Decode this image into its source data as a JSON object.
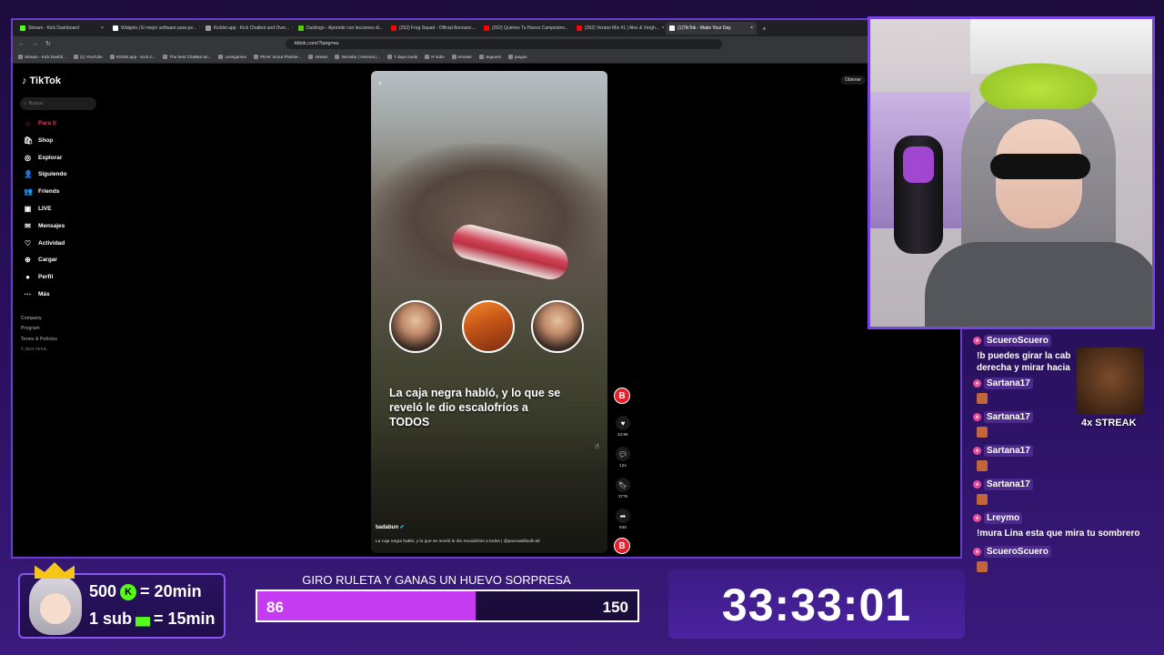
{
  "browser": {
    "tabs": [
      {
        "label": "Stream - Kick Dashboard",
        "color": "#53fc18"
      },
      {
        "label": "Widgets | El mejor software para pe...",
        "color": "#ffffff"
      },
      {
        "label": "Kicklet.app - Kick Chatbot and Over...",
        "color": "#9b9b9b"
      },
      {
        "label": "Duolingo - Aprende con lecciones di...",
        "color": "#58cc02"
      },
      {
        "label": "(262) Frog Squad - Official Announc...",
        "color": "#ff0000"
      },
      {
        "label": "(262) Quieres Tu Huevo Campesino...",
        "color": "#ff0000"
      },
      {
        "label": "(262) Verano Mix #1 | Alex & Vergh...",
        "color": "#ff0000"
      },
      {
        "label": "(1)TikTok - Make Your Day",
        "color": "#ffffff"
      }
    ],
    "url": "tiktok.com/?lang=es",
    "bookmarks": [
      "Stream - Kick Dashb...",
      "(1) YouTube",
      "Kicklet.app - Kick C...",
      "The best ChatBot an...",
      "Lessgames",
      "PEAK Scout Plushie...",
      "stream",
      "Servidor | Aternos |...",
      "7 days mods",
      "R subs",
      "emotes",
      "Jeguoes",
      "juegos"
    ]
  },
  "tiktok": {
    "logo": "TikTok",
    "search_placeholder": "Buscar",
    "nav": [
      {
        "label": "Para ti",
        "icon": "home-icon",
        "glyph": "⌂"
      },
      {
        "label": "Shop",
        "icon": "shop-icon",
        "glyph": "🛍"
      },
      {
        "label": "Explorar",
        "icon": "compass-icon",
        "glyph": "◎"
      },
      {
        "label": "Siguiendo",
        "icon": "following-icon",
        "glyph": "👤"
      },
      {
        "label": "Friends",
        "icon": "friends-icon",
        "glyph": "👥"
      },
      {
        "label": "LIVE",
        "icon": "live-icon",
        "glyph": "▣"
      },
      {
        "label": "Mensajes",
        "icon": "messages-icon",
        "glyph": "✉"
      },
      {
        "label": "Actividad",
        "icon": "activity-icon",
        "glyph": "♡"
      },
      {
        "label": "Cargar",
        "icon": "upload-icon",
        "glyph": "⊕"
      },
      {
        "label": "Perfil",
        "icon": "profile-icon",
        "glyph": "●"
      },
      {
        "label": "Más",
        "icon": "more-icon",
        "glyph": "···"
      }
    ],
    "footer": [
      "Company",
      "Program",
      "Terms & Policies",
      "© 2024 TikTok"
    ],
    "get_app": "Obtener",
    "video": {
      "caption": "La caja negra habló, y lo que se reveló le dio escalofríos a TODOS",
      "author": "badabun",
      "description": "La caja negra habló, y lo que se reveló le dio escalofríos a todos | @paocastillooficial"
    },
    "actions": {
      "likes": "43.9K",
      "comments": "124",
      "saves": "3776",
      "shares": "848"
    }
  },
  "chat": {
    "messages": [
      {
        "user": "ScueroScuero",
        "text": "!b puedes girar la cab derecha y mirar hacia"
      },
      {
        "user": "Sartana17",
        "text": ""
      },
      {
        "user": "Sartana17",
        "text": ""
      },
      {
        "user": "Sartana17",
        "text": ""
      },
      {
        "user": "Sartana17",
        "text": ""
      },
      {
        "user": "Lreymo",
        "text": "!mura Lina esta que mira tu sombrero"
      },
      {
        "user": "ScueroScuero",
        "text": ""
      }
    ],
    "streak": "4x STREAK"
  },
  "overlay": {
    "sub_line1": {
      "amount": "500",
      "coin": "K",
      "reward": "= 20min"
    },
    "sub_line2": {
      "amount": "1 sub",
      "reward": "= 15min"
    },
    "goal_title": "GIRO RULETA Y GANAS UN HUEVO SORPRESA",
    "goal_current": "86",
    "goal_max": "150",
    "goal_progress": 0.573,
    "timer": "33:33:01",
    "colors": {
      "accent": "#8a55ec",
      "goal_fill": "#c53bf2",
      "kick_green": "#53fc18",
      "tiktok_red": "#fe2c55"
    }
  }
}
